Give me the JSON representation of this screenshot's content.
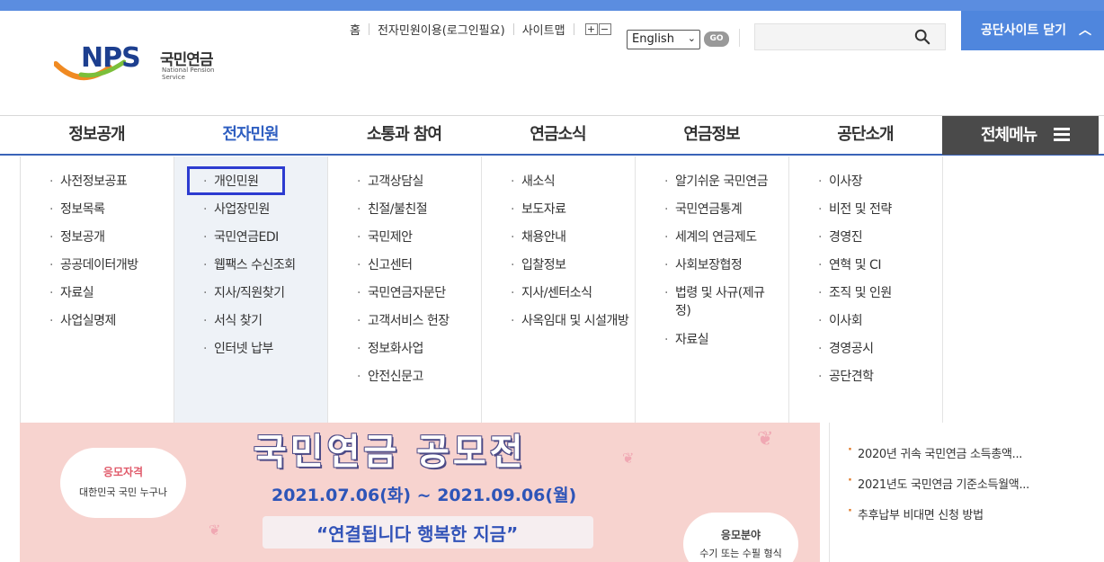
{
  "brand": {
    "logo_letters": "NPS",
    "logo_korean": "국민연금",
    "logo_english": "National Pension Service"
  },
  "utility": {
    "home": "홈",
    "civil_login": "전자민원이용(로그인필요)",
    "sitemap": "사이트맵",
    "font_plus": "+",
    "font_minus": "−",
    "language_selected": "English",
    "go_label": "GO",
    "close_site_label": "공단사이트 닫기",
    "search_value": ""
  },
  "gnb": {
    "items": [
      "정보공개",
      "전자민원",
      "소통과 참여",
      "연금소식",
      "연금정보",
      "공단소개"
    ],
    "active_index": 1,
    "all_menu_label": "전체메뉴"
  },
  "submenus": [
    [
      "사전정보공표",
      "정보목록",
      "정보공개",
      "공공데이터개방",
      "자료실",
      "사업실명제"
    ],
    [
      "개인민원",
      "사업장민원",
      "국민연금EDI",
      "웹팩스 수신조회",
      "지사/직원찾기",
      "서식 찾기",
      "인터넷 납부"
    ],
    [
      "고객상담실",
      "친절/불친절",
      "국민제안",
      "신고센터",
      "국민연금자문단",
      "고객서비스 헌장",
      "정보화사업",
      "안전신문고"
    ],
    [
      "새소식",
      "보도자료",
      "채용안내",
      "입찰정보",
      "지사/센터소식",
      "사옥임대 및 시설개방"
    ],
    [
      "알기쉬운 국민연금",
      "국민연금통계",
      "세계의 연금제도",
      "사회보장협정",
      "법령 및 사규(제규정)",
      "자료실"
    ],
    [
      "이사장",
      "비전 및 전략",
      "경영진",
      "연혁 및 CI",
      "조직 및 인원",
      "이사회",
      "경영공시",
      "공단견학"
    ]
  ],
  "highlighted_item": "개인민원",
  "banner": {
    "title": "국민연금 공모전",
    "date": "2021.07.06(화) ~ 2021.09.06(월)",
    "slogan": "“연결됩니다 행복한 지금”",
    "eligibility_head": "응모자격",
    "eligibility_text": "대한민국 국민 누구나",
    "category_head": "응모분야",
    "category_text": "수기 또는 수필 형식"
  },
  "news": {
    "items": [
      "2020년 귀속 국민연금 소득총액...",
      "2021년도 국민연금 기준소득월액...",
      "추후납부 비대면 신청 방법"
    ]
  }
}
